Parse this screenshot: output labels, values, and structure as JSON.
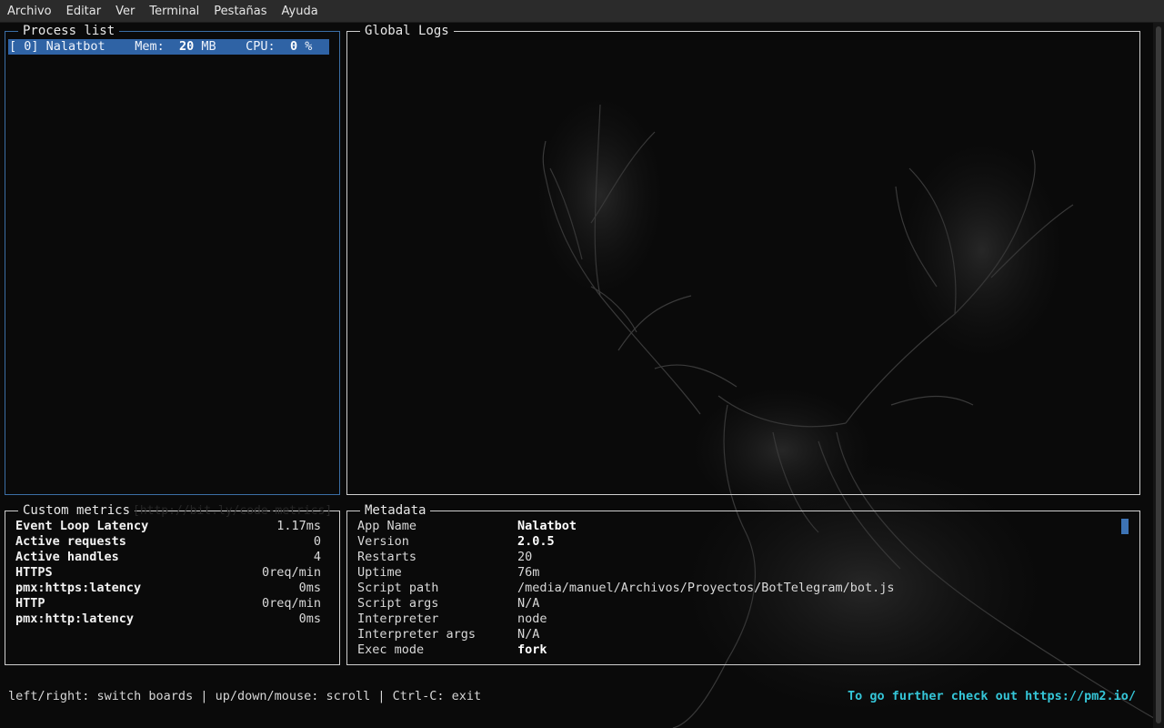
{
  "menu": [
    "Archivo",
    "Editar",
    "Ver",
    "Terminal",
    "Pestañas",
    "Ayuda"
  ],
  "process_list": {
    "title": "Process list",
    "rows": [
      {
        "index": "[ 0]",
        "name": "Nalatbot",
        "mem_label": "Mem:",
        "mem_value": "20",
        "mem_unit": "MB",
        "cpu_label": "CPU:",
        "cpu_value": "0",
        "cpu_unit": "%"
      }
    ]
  },
  "logs": {
    "title": "Global Logs"
  },
  "metrics": {
    "title": "Custom metrics",
    "watermark": "[http://bit.ly/code-metrics]",
    "rows": [
      {
        "key": "Event Loop Latency",
        "value": "1.17ms"
      },
      {
        "key": "Active requests",
        "value": "0"
      },
      {
        "key": "Active handles",
        "value": "4"
      },
      {
        "key": "HTTPS",
        "value": "0req/min"
      },
      {
        "key": "pmx:https:latency",
        "value": "0ms"
      },
      {
        "key": "HTTP",
        "value": "0req/min"
      },
      {
        "key": "pmx:http:latency",
        "value": "0ms"
      }
    ]
  },
  "metadata": {
    "title": "Metadata",
    "rows": [
      {
        "key": "App Name",
        "value": "Nalatbot",
        "bold": true
      },
      {
        "key": "Version",
        "value": "2.0.5",
        "bold": true
      },
      {
        "key": "Restarts",
        "value": "20",
        "bold": false
      },
      {
        "key": "Uptime",
        "value": "76m",
        "bold": false
      },
      {
        "key": "Script path",
        "value": "/media/manuel/Archivos/Proyectos/BotTelegram/bot.js",
        "bold": false
      },
      {
        "key": "Script args",
        "value": "N/A",
        "bold": false
      },
      {
        "key": "Interpreter",
        "value": "node",
        "bold": false
      },
      {
        "key": "Interpreter args",
        "value": "N/A",
        "bold": false
      },
      {
        "key": "Exec mode",
        "value": "fork",
        "bold": true
      }
    ]
  },
  "footer": {
    "help": "left/right: switch boards | up/down/mouse: scroll | Ctrl-C: exit",
    "link": "To go further check out https://pm2.io/"
  },
  "colors": {
    "selection": "#2f63a5",
    "link": "#35c6d8",
    "background": "#0a0a0a"
  }
}
